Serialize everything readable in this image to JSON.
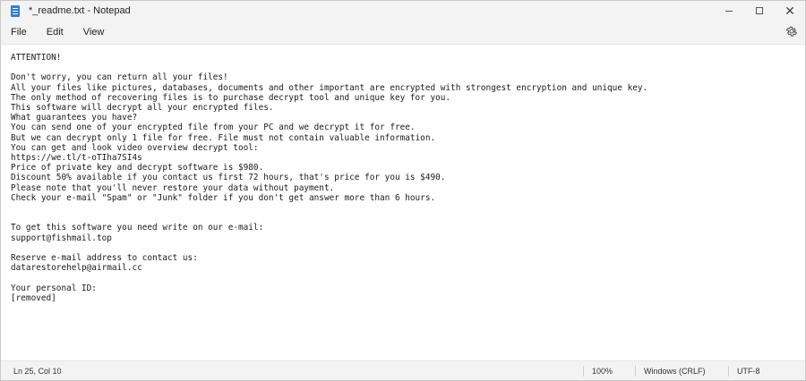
{
  "window": {
    "title": "*_readme.txt - Notepad",
    "app_icon": "notepad-icon"
  },
  "menu": {
    "file": "File",
    "edit": "Edit",
    "view": "View",
    "settings_icon": "gear-icon"
  },
  "document": {
    "text": "ATTENTION!\n\nDon't worry, you can return all your files!\nAll your files like pictures, databases, documents and other important are encrypted with strongest encryption and unique key.\nThe only method of recovering files is to purchase decrypt tool and unique key for you.\nThis software will decrypt all your encrypted files.\nWhat guarantees you have?\nYou can send one of your encrypted file from your PC and we decrypt it for free.\nBut we can decrypt only 1 file for free. File must not contain valuable information.\nYou can get and look video overview decrypt tool:\nhttps://we.tl/t-oTIha7SI4s\nPrice of private key and decrypt software is $980.\nDiscount 50% available if you contact us first 72 hours, that's price for you is $490.\nPlease note that you'll never restore your data without payment.\nCheck your e-mail \"Spam\" or \"Junk\" folder if you don't get answer more than 6 hours.\n\n\nTo get this software you need write on our e-mail:\nsupport@fishmail.top\n\nReserve e-mail address to contact us:\ndatarestorehelp@airmail.cc\n\nYour personal ID:\n[removed]"
  },
  "status": {
    "position": "Ln 25, Col 10",
    "zoom": "100%",
    "line_ending": "Windows (CRLF)",
    "encoding": "UTF-8"
  }
}
